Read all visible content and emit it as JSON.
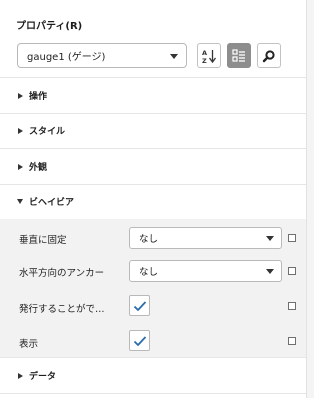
{
  "panel": {
    "title": "プロパティ(R)",
    "object_selector": {
      "value": "gauge1 (ゲージ)"
    },
    "toolbar": {
      "sort_alpha_icon": "sort-alphabetical-icon",
      "categorized_icon": "categorized-view-icon",
      "search_icon": "search-icon"
    }
  },
  "sections": {
    "operation": {
      "label": "操作",
      "expanded": false
    },
    "style": {
      "label": "スタイル",
      "expanded": false
    },
    "appearance": {
      "label": "外観",
      "expanded": false
    },
    "behavior": {
      "label": "ビヘイビア",
      "expanded": true,
      "properties": [
        {
          "label": "垂直に固定",
          "type": "select",
          "value": "なし"
        },
        {
          "label": "水平方向のアンカー",
          "type": "select",
          "value": "なし"
        },
        {
          "label": "発行することがで…",
          "type": "checkbox",
          "checked": true
        },
        {
          "label": "表示",
          "type": "checkbox",
          "checked": true
        }
      ]
    },
    "data": {
      "label": "データ",
      "expanded": false
    }
  },
  "colors": {
    "accent": "#2b6cb0",
    "active_tool": "#8d8d8d",
    "expanded_bg": "#f2f2f2"
  }
}
